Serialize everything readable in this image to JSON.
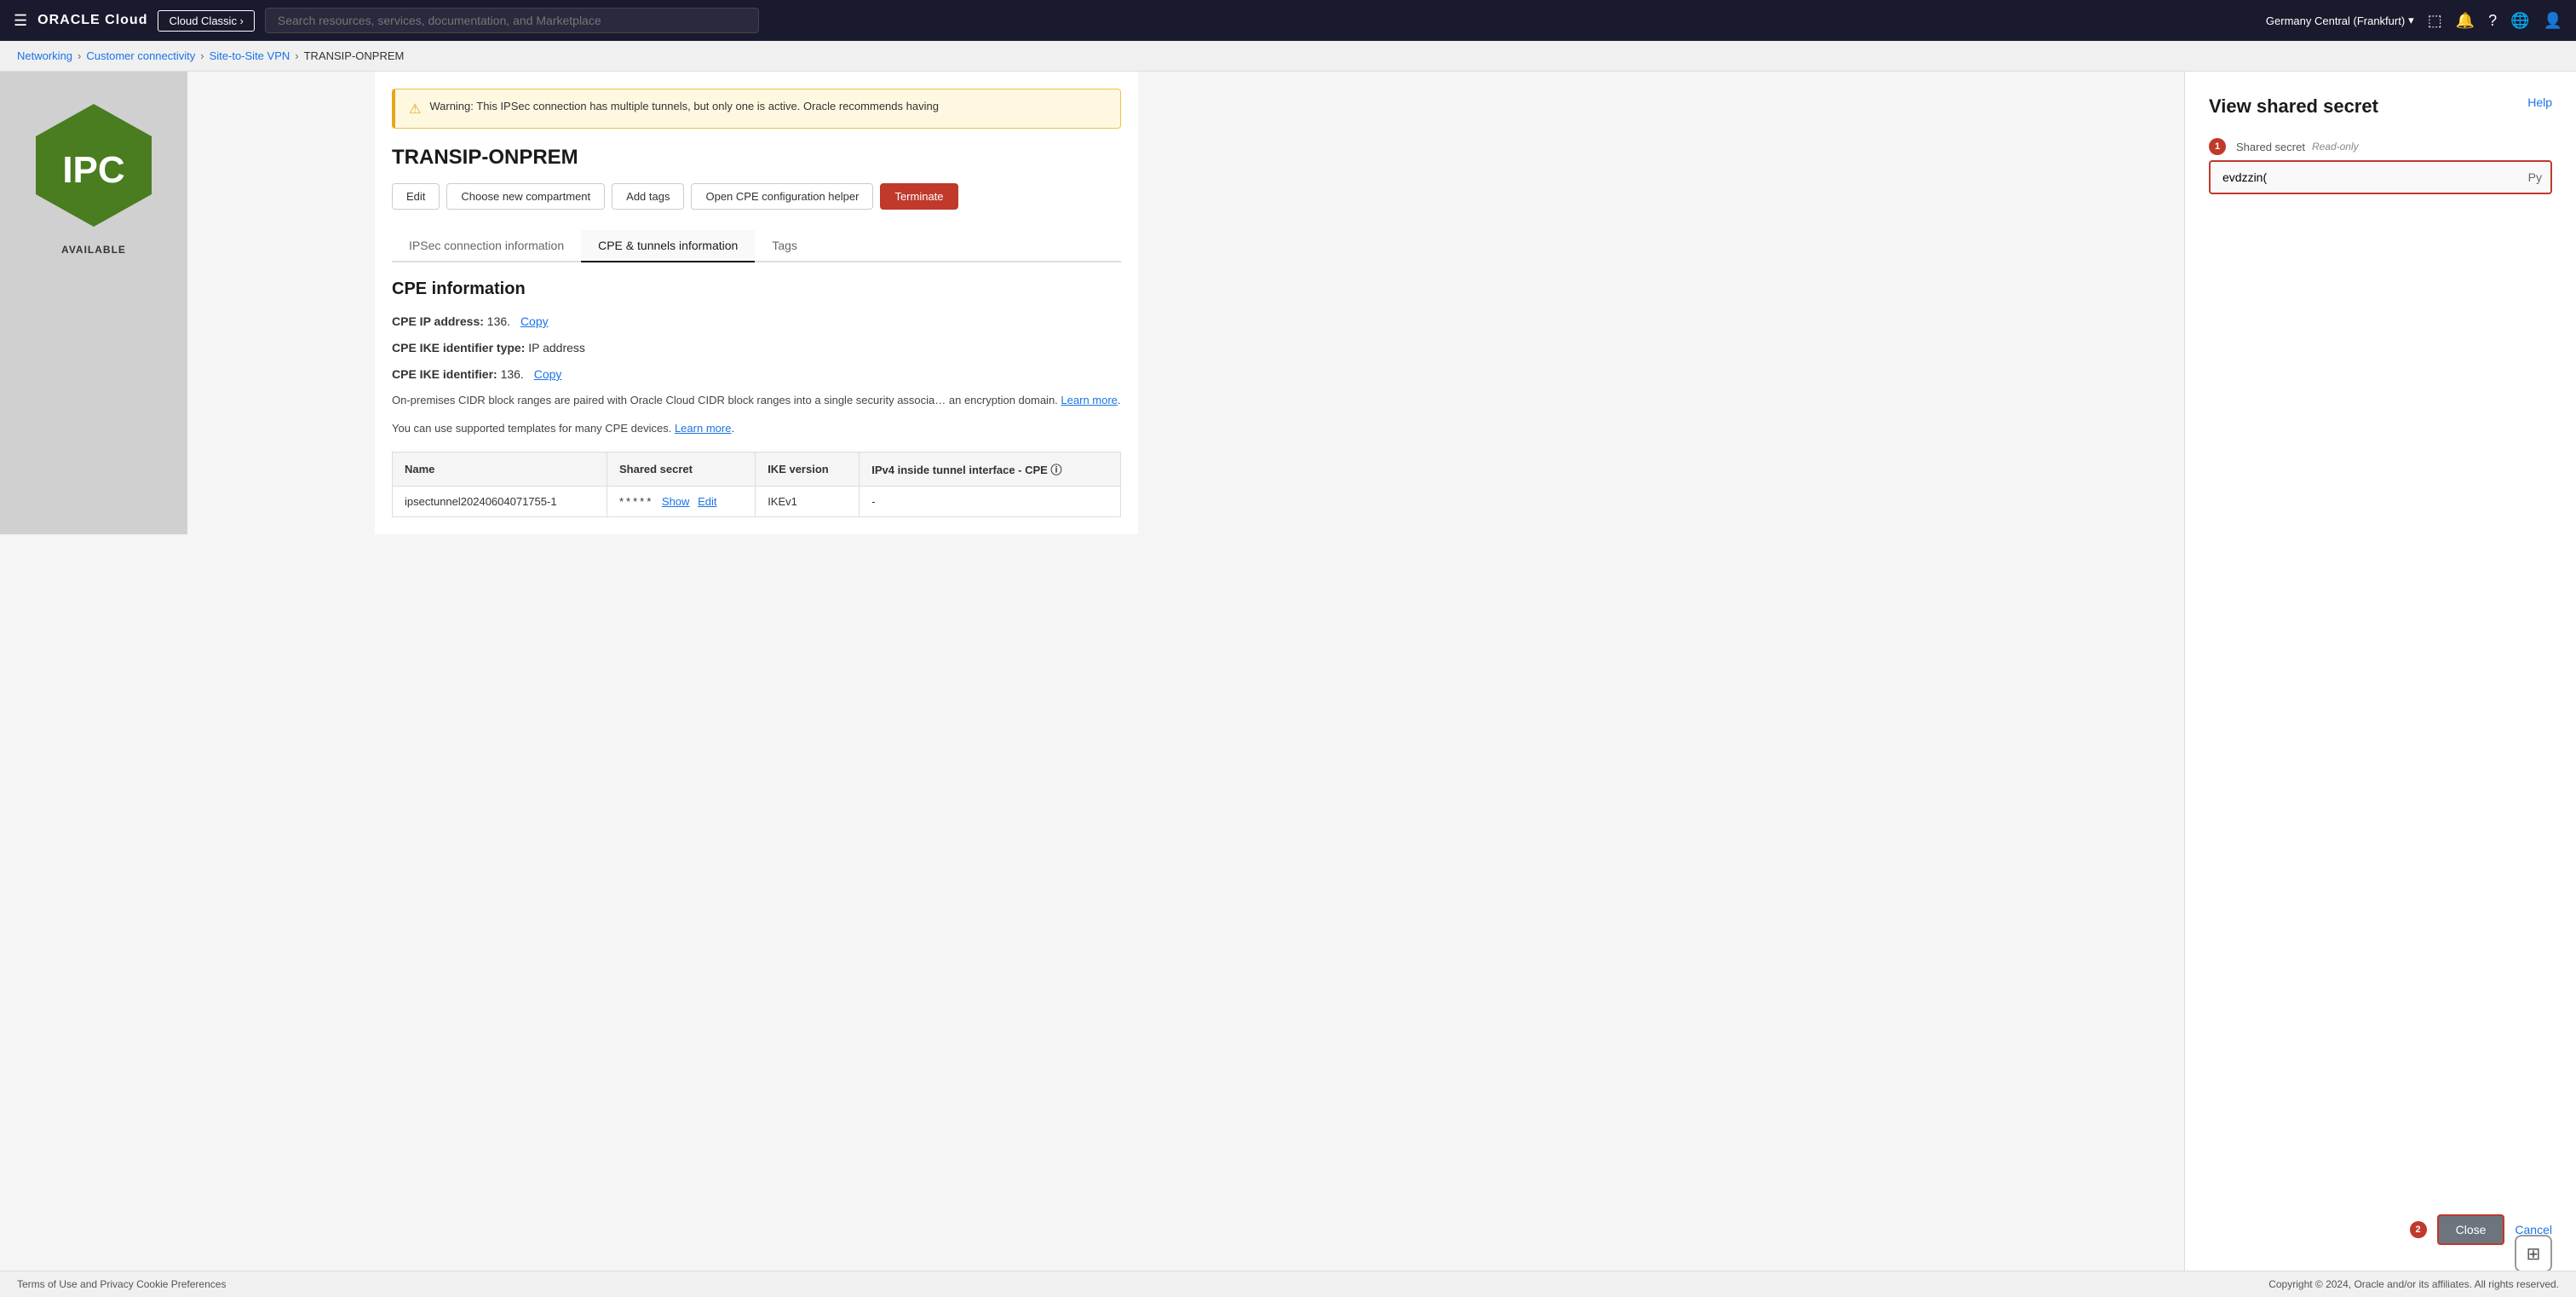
{
  "nav": {
    "hamburger": "☰",
    "oracle_text": "ORACLE",
    "cloud_text": " Cloud",
    "cloud_classic_label": "Cloud Classic ›",
    "search_placeholder": "Search resources, services, documentation, and Marketplace",
    "region": "Germany Central (Frankfurt)",
    "region_chevron": "▾"
  },
  "breadcrumb": {
    "networking": "Networking",
    "customer_connectivity": "Customer connectivity",
    "site_to_site_vpn": "Site-to-Site VPN",
    "current": "TRANSIP-ONPREM"
  },
  "main": {
    "ipc_text": "IPC",
    "status": "AVAILABLE",
    "warning_text": "Warning: This IPSec connection has multiple tunnels, but only one is active. Oracle recommends having",
    "resource_title": "TRANSIP-ONPREM",
    "buttons": {
      "edit": "Edit",
      "choose_compartment": "Choose new compartment",
      "add_tags": "Add tags",
      "open_cpe": "Open CPE configuration helper",
      "terminate": "Terminate"
    },
    "tabs": [
      {
        "id": "ipsec",
        "label": "IPSec connection information"
      },
      {
        "id": "cpe",
        "label": "CPE & tunnels information",
        "active": true
      },
      {
        "id": "tags",
        "label": "Tags"
      }
    ],
    "cpe_section": {
      "title": "CPE information",
      "cpe_ip_label": "CPE IP address:",
      "cpe_ip_value": "136.",
      "copy_label": "Copy",
      "cpe_ike_type_label": "CPE IKE identifier type:",
      "cpe_ike_type_value": "IP address",
      "cpe_ike_id_label": "CPE IKE identifier:",
      "cpe_ike_id_value": "136.",
      "description1": "On-premises CIDR block ranges are paired with Oracle Cloud CIDR block ranges into a single security associa… an encryption domain.",
      "learn_more1": "Learn more",
      "description2": "You can use supported templates for many CPE devices.",
      "learn_more2": "Learn more",
      "table": {
        "headers": [
          "Name",
          "Shared secret",
          "IKE version",
          "IPv4 inside tunnel interface - CPE ⓘ"
        ],
        "rows": [
          {
            "name": "ipsectunnel20240604071755-1",
            "shared_secret_dots": "*****",
            "show": "Show",
            "edit": "Edit",
            "ike_version": "IKEv1",
            "ipv4_interface": "-"
          }
        ]
      }
    }
  },
  "right_panel": {
    "title": "View shared secret",
    "help_label": "Help",
    "step1_badge": "1",
    "field_label": "Shared secret",
    "read_only_label": "Read-only",
    "secret_value": "evdzzin(",
    "secret_suffix": "Py",
    "step2_badge": "2",
    "close_label": "Close",
    "cancel_label": "Cancel",
    "help_widget_icon": "⊞"
  },
  "footer": {
    "left": "Terms of Use and Privacy",
    "separator": "   ",
    "cookie": "Cookie Preferences",
    "right": "Copyright © 2024, Oracle and/or its affiliates. All rights reserved."
  }
}
